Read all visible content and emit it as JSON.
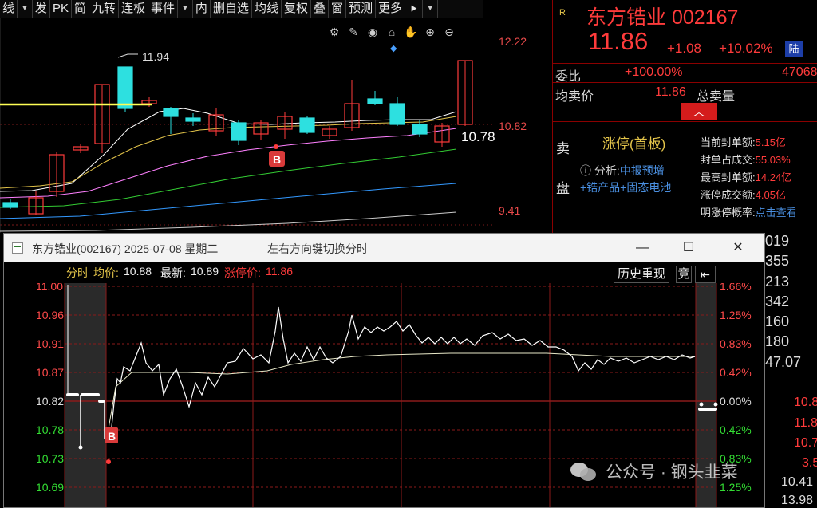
{
  "toolbar": {
    "items": [
      "线",
      "发",
      "PK",
      "简",
      "九转",
      "连板",
      "事件",
      "内",
      "删自选",
      "均线",
      "复权",
      "叠",
      "窗",
      "预测",
      "更多"
    ],
    "dropdown_glyph": "▼",
    "nav_glyph": "⯈"
  },
  "kline": {
    "axis_ticks": [
      "12.22",
      "10.82",
      "9.41"
    ],
    "high_label": "11.94",
    "current_label": "10.78",
    "buy_marker": "B"
  },
  "quote": {
    "r_mark": "R",
    "name": "东方锆业",
    "code": "002167",
    "price": "11.86",
    "change": "+1.08",
    "change_pct": "+10.02%",
    "lu_badge": "陆",
    "weibi_label": "委比",
    "weibi_value": "+100.00%",
    "weibi_num": "47068",
    "junmai_label": "均卖价",
    "junmai_value": "11.86",
    "zongmai_label": "总卖量",
    "up_arrow": "︿",
    "side_labels": [
      "卖",
      "盘"
    ],
    "limit_tag": "涨停(首板)",
    "analysis_label": "分析:",
    "analysis_text": "中报预增+锆产品+固态电池",
    "metrics": [
      {
        "label": "当前封单额:",
        "value": "5.15亿"
      },
      {
        "label": "封单占成交:",
        "value": "55.03%"
      },
      {
        "label": "最高封单额:",
        "value": "14.24亿"
      },
      {
        "label": "涨停成交额:",
        "value": "4.05亿"
      },
      {
        "label": "明涨停概率:",
        "value": "点击查看"
      }
    ]
  },
  "popup": {
    "title": "东方锆业(002167) 2025-07-08 星期二",
    "hint": "左右方向键切换分时",
    "header": {
      "fenshi": "分时",
      "avg_label": "均价:",
      "avg_value": "10.88",
      "latest_label": "最新:",
      "latest_value": "10.89",
      "limit_label": "涨停价:",
      "limit_value": "11.86"
    },
    "history_button": "历史重现",
    "liang_button": "竞",
    "back_glyph": "⇤",
    "price_ticks": [
      "11.00",
      "10.96",
      "10.91",
      "10.87",
      "10.82",
      "10.78",
      "10.73",
      "10.69"
    ],
    "pct_ticks": [
      "1.66%",
      "1.25%",
      "0.83%",
      "0.42%",
      "0.00%",
      "0.42%",
      "0.83%",
      "1.25%"
    ],
    "buy_marker": "B"
  },
  "strip": {
    "values": [
      "019",
      "355",
      "213",
      "342",
      "160",
      "180",
      "47.07"
    ],
    "red_values": [
      "10.8",
      "11.8",
      "10.7",
      "3.5",
      "10.41",
      "13.98"
    ]
  },
  "watermark": "公众号 · 钢头韭菜",
  "colors": {
    "up": "#ff3b3b",
    "down": "#2de0e0",
    "accent_yellow": "#e3c44a",
    "link_blue": "#4a8fe0",
    "title_bg": "#f3f3f3"
  }
}
